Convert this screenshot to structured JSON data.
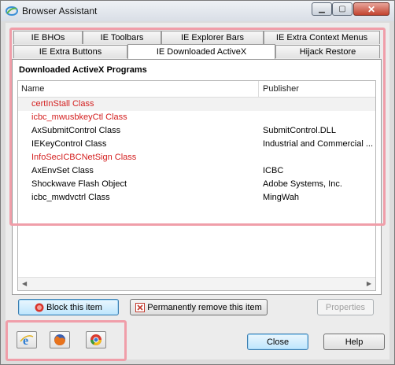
{
  "window": {
    "title": "Browser Assistant"
  },
  "tabs_row1": [
    "IE BHOs",
    "IE Toolbars",
    "IE Explorer Bars",
    "IE Extra Context Menus"
  ],
  "tabs_row2": [
    "IE Extra Buttons",
    "IE Downloaded ActiveX",
    "Hijack Restore"
  ],
  "active_tab": "IE Downloaded ActiveX",
  "panel": {
    "title": "Downloaded ActiveX Programs",
    "columns": [
      "Name",
      "Publisher"
    ],
    "rows": [
      {
        "name": "certInStall Class",
        "publisher": "",
        "color": "#d42020"
      },
      {
        "name": "icbc_mwusbkeyCtl Class",
        "publisher": "",
        "color": "#d42020"
      },
      {
        "name": "AxSubmitControl Class",
        "publisher": "SubmitControl.DLL",
        "color": "#000000"
      },
      {
        "name": "IEKeyControl Class",
        "publisher": "Industrial and Commercial ...",
        "color": "#000000"
      },
      {
        "name": "InfoSecICBCNetSign Class",
        "publisher": "",
        "color": "#d42020"
      },
      {
        "name": "AxEnvSet Class",
        "publisher": "ICBC",
        "color": "#000000"
      },
      {
        "name": "Shockwave Flash Object",
        "publisher": "Adobe Systems, Inc.",
        "color": "#000000"
      },
      {
        "name": "icbc_mwdvctrl Class",
        "publisher": "MingWah",
        "color": "#000000"
      }
    ]
  },
  "buttons": {
    "block": "Block this item",
    "remove": "Permanently remove this item",
    "properties": "Properties",
    "close": "Close",
    "help": "Help"
  },
  "browsers": [
    "internet-explorer-icon",
    "firefox-icon",
    "chrome-icon"
  ],
  "highlight_color": "#f09ea9"
}
